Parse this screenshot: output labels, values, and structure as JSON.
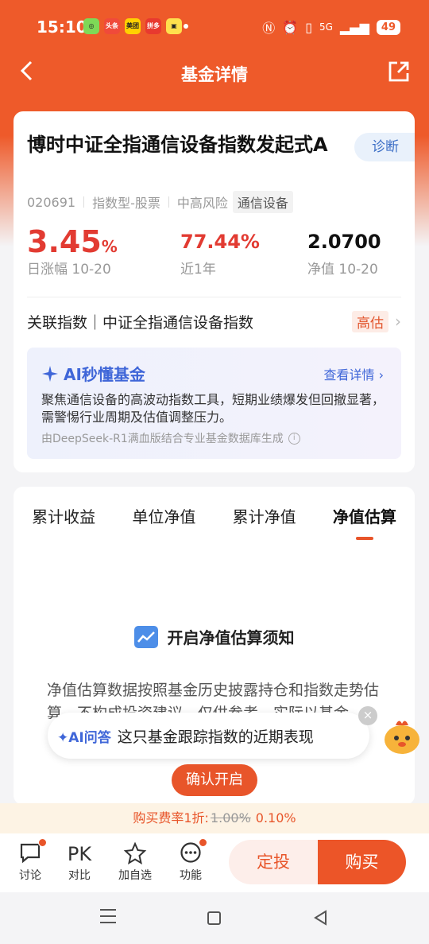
{
  "status_bar": {
    "time": "15:10",
    "apps": [
      "头条",
      "美团",
      "拼多"
    ],
    "network": "5G",
    "battery": "49"
  },
  "nav": {
    "title": "基金详情"
  },
  "fund": {
    "name": "博时中证全指通信设备指数发起式A",
    "diagnose_label": "诊断",
    "code": "020691",
    "type": "指数型-股票",
    "risk": "中高风险",
    "sector_tag": "通信设备",
    "daily_change": "3.45",
    "daily_change_unit": "%",
    "daily_change_label": "日涨幅 10-20",
    "year_return": "77.44%",
    "year_return_label": "近1年",
    "nav_value": "2.0700",
    "nav_label": "净值 10-20",
    "index_link": "关联指数｜中证全指通信设备指数",
    "valuation_tag": "高估"
  },
  "ai_summary": {
    "title": "AI秒懂基金",
    "more_label": "查看详情",
    "text": "聚焦通信设备的高波动指数工具，短期业绩爆发但回撤显著，需警惕行业周期及估值调整压力。",
    "source": "由DeepSeek-R1满血版结合专业基金数据库生成"
  },
  "tabs": [
    "累计收益",
    "单位净值",
    "累计净值",
    "净值估算"
  ],
  "active_tab": 3,
  "notice": {
    "title": "开启净值估算须知",
    "text": "净值估算数据按照基金历史披露持仓和指数走势估算，不构成投资建议，仅供参考，实际以基金",
    "confirm_label": "确认开启"
  },
  "ai_qa": {
    "badge": "AI问答",
    "question": "这只基金跟踪指数的近期表现"
  },
  "fee": {
    "prefix": "购买费率1折:",
    "original": "1.00%",
    "discounted": "0.10%"
  },
  "bottom_bar": {
    "items": [
      {
        "label": "讨论",
        "icon": "chat-icon"
      },
      {
        "label": "对比",
        "icon_text": "PK"
      },
      {
        "label": "加自选",
        "icon": "star-icon"
      },
      {
        "label": "功能",
        "icon": "more-icon"
      }
    ],
    "dingtou_label": "定投",
    "buy_label": "购买"
  },
  "colors": {
    "brand": "#ee5a2a",
    "rise": "#e23b32",
    "ai_blue": "#3f66d8"
  }
}
